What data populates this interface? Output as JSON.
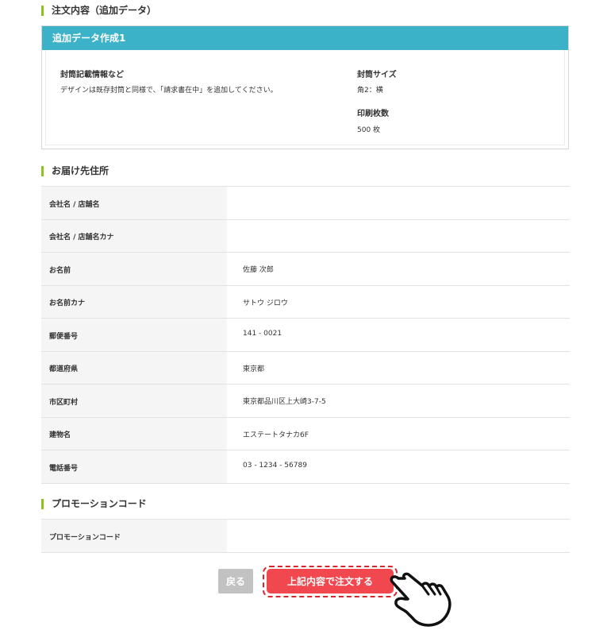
{
  "order_section": {
    "heading": "注文内容（追加データ）",
    "card_title": "追加データ作成1",
    "envelope_info_label": "封筒記載情報など",
    "envelope_info_value": "デザインは既存封筒と同様で、「請求書在中」を追加してください。",
    "envelope_size_label": "封筒サイズ",
    "envelope_size_value": "角2：横",
    "print_count_label": "印刷枚数",
    "print_count_value": "500 枚"
  },
  "delivery_section": {
    "heading": "お届け先住所",
    "rows": [
      {
        "label": "会社名 / 店舗名",
        "value": ""
      },
      {
        "label": "会社名 / 店舗名カナ",
        "value": ""
      },
      {
        "label": "お名前",
        "value": "佐藤 次郎"
      },
      {
        "label": "お名前カナ",
        "value": "サトウ ジロウ"
      },
      {
        "label": "郵便番号",
        "value": "141 - 0021"
      },
      {
        "label": "都道府県",
        "value": "東京都"
      },
      {
        "label": "市区町村",
        "value": "東京都品川区上大崎3-7-5"
      },
      {
        "label": "建物名",
        "value": "エステートタナカ6F"
      },
      {
        "label": "電話番号",
        "value": "03 - 1234 - 56789"
      }
    ]
  },
  "promo_section": {
    "heading": "プロモーションコード",
    "rows": [
      {
        "label": "プロモーションコード",
        "value": ""
      }
    ]
  },
  "actions": {
    "back_label": "戻る",
    "submit_label": "上記内容で注文する"
  },
  "colors": {
    "accent_green": "#8dc21f",
    "card_header": "#3cb2c9",
    "submit_red": "#f0484e",
    "back_gray": "#c2c2c2"
  },
  "icons": {
    "pointer": "pointing-hand-icon"
  }
}
